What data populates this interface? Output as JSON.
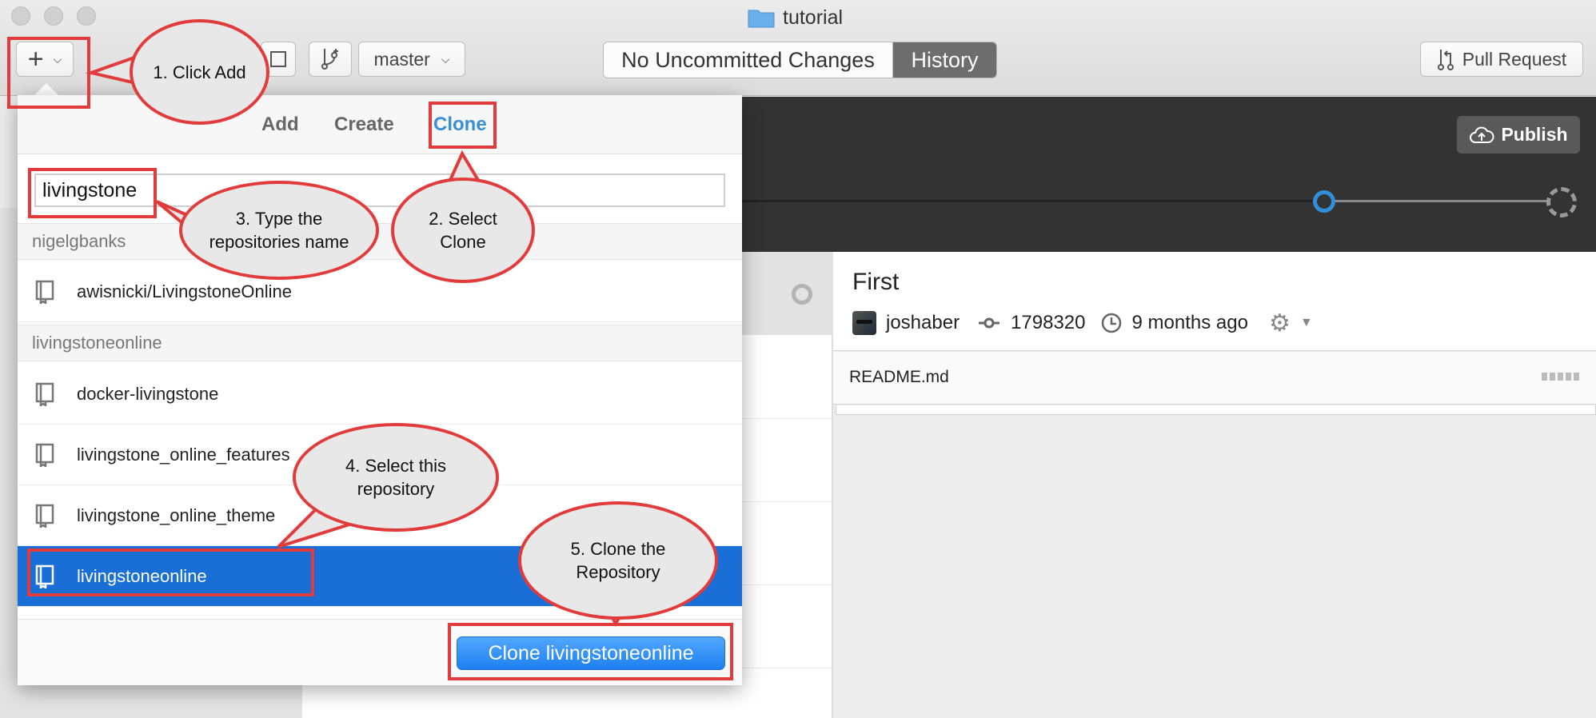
{
  "window": {
    "title": "tutorial"
  },
  "toolbar": {
    "branch": "master",
    "segments": [
      "No Uncommitted Changes",
      "History"
    ],
    "pull_request": "Pull Request"
  },
  "header": {
    "publish": "Publish"
  },
  "commit": {
    "title": "First",
    "author": "joshaber",
    "sha": "1798320",
    "time": "9 months ago",
    "file": "README.md"
  },
  "popover": {
    "tabs": [
      "Add",
      "Create",
      "Clone"
    ],
    "active_tab": "Clone",
    "search_value": "livingstone",
    "sections": [
      {
        "name": "nigelgbanks",
        "repos": [
          "awisnicki/LivingstoneOnline"
        ]
      },
      {
        "name": "livingstoneonline",
        "repos": [
          "docker-livingstone",
          "livingstone_online_features",
          "livingstone_online_theme",
          "livingstoneonline"
        ]
      }
    ],
    "selected_repo": "livingstoneonline",
    "clone_button": "Clone livingstoneonline"
  },
  "annotations": {
    "step1": "1. Click Add",
    "step2": "2. Select Clone",
    "step3": "3. Type the repositories name",
    "step4": "4. Select this repository",
    "step5": "5. Clone the Repository",
    "color": "#e23b3b"
  },
  "colors": {
    "accent": "#1a6fd7",
    "clone_tab": "#3a8ed6",
    "timeline_node": "#2f8fdd"
  }
}
